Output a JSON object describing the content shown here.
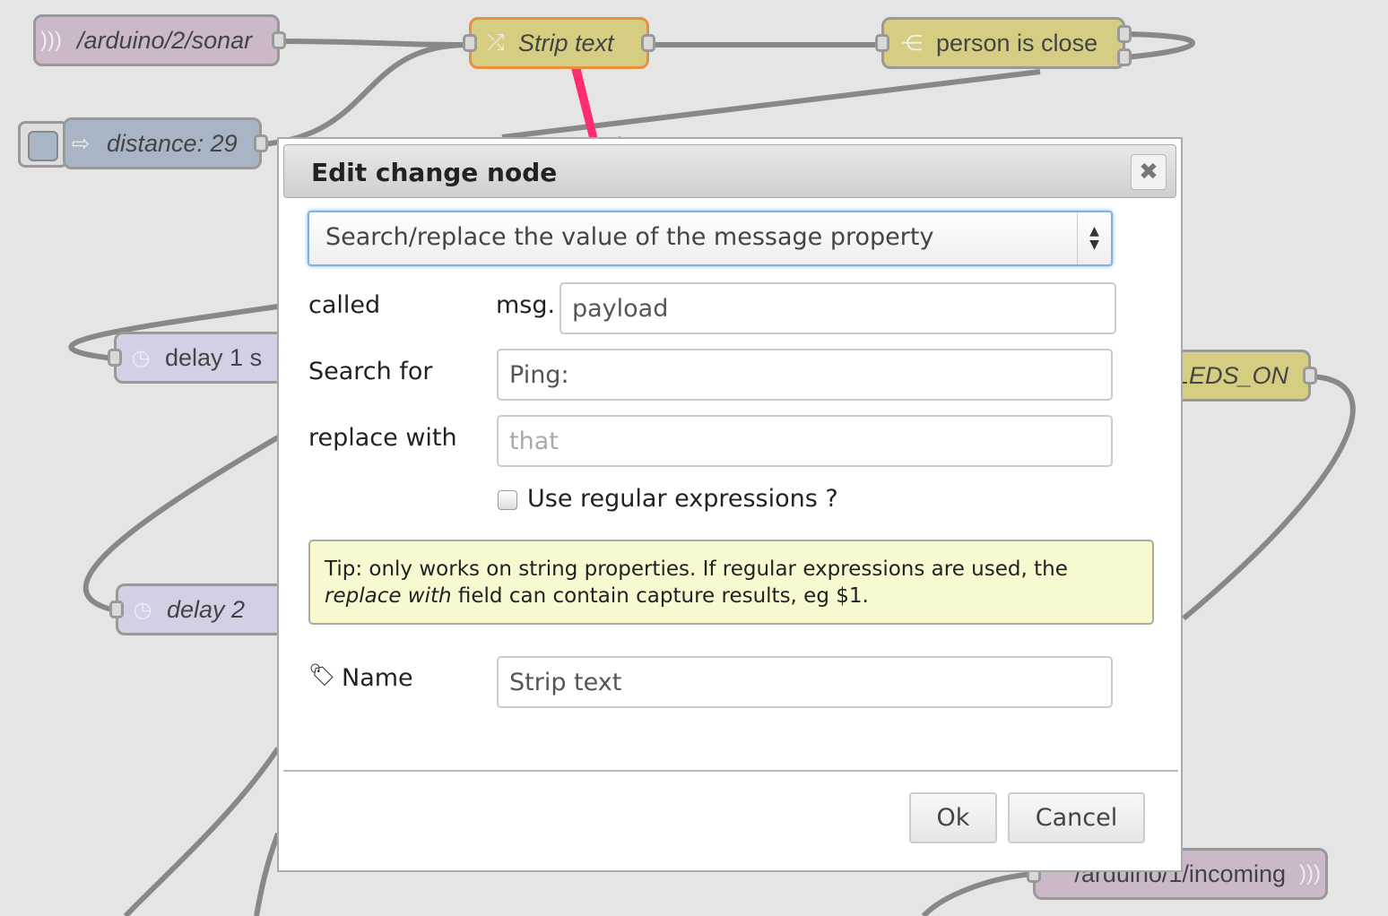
{
  "canvas": {
    "nodes": [
      {
        "id": "sonar",
        "label": "/arduino/2/sonar",
        "icon": "radio-waves-icon",
        "color": "#cbb8c9"
      },
      {
        "id": "strip",
        "label": "Strip text",
        "icon": "shuffle-icon",
        "color": "#d4cd82",
        "selected_border": "#e8903f"
      },
      {
        "id": "person",
        "label": "person is close",
        "icon": "switch-icon",
        "color": "#d4cd82"
      },
      {
        "id": "distance",
        "label": "distance: 29",
        "icon": "inject-arrow-icon",
        "color": "#a7b5c4"
      },
      {
        "id": "delay1",
        "label": "delay 1 s",
        "icon": "timer-icon",
        "color": "#d4cfe4"
      },
      {
        "id": "delay2",
        "label": "delay 2",
        "icon": "timer-icon",
        "color": "#d4cfe4"
      },
      {
        "id": "leds",
        "label": "LEDS_ON",
        "color": "#d4cd82"
      },
      {
        "id": "incoming",
        "label": "/arduino/1/incoming",
        "icon": "radio-waves-icon",
        "color": "#cbb8c9"
      }
    ],
    "annotation_arrow_color": "#ff2d6f"
  },
  "dialog": {
    "title": "Edit change node",
    "close_icon": "close-icon",
    "action_select": "Search/replace the value of the message property",
    "called_label": "called",
    "msg_prefix": "msg.",
    "property_value": "payload",
    "search_label": "Search for",
    "search_value": "Ping:",
    "replace_label": "replace with",
    "replace_placeholder": "that",
    "regex_label": "Use regular expressions ?",
    "regex_checked": false,
    "tip_prefix": "Tip: only works on string properties. If regular expressions are used, the",
    "tip_em": "replace with",
    "tip_suffix": " field can contain capture results, eg $1.",
    "name_label": "Name",
    "name_value": "Strip text",
    "ok_label": "Ok",
    "cancel_label": "Cancel"
  }
}
